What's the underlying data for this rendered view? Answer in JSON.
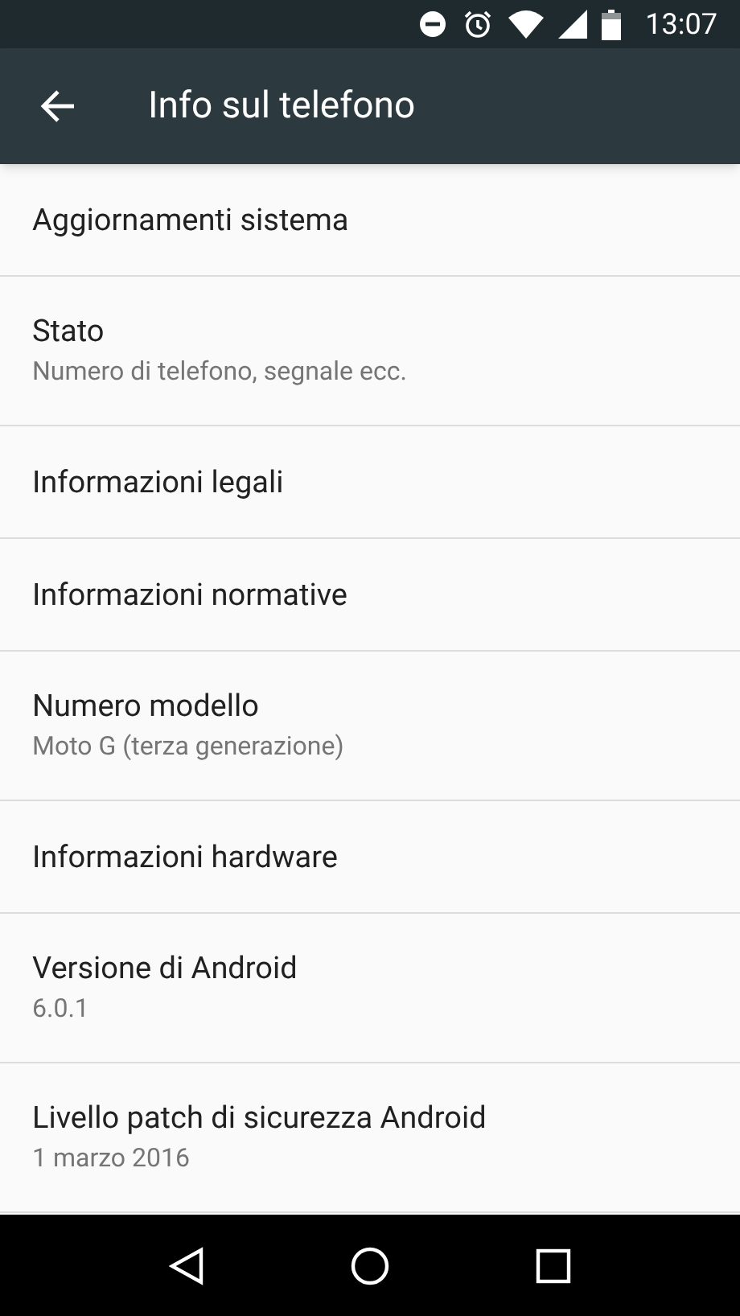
{
  "status_bar": {
    "time": "13:07"
  },
  "toolbar": {
    "title": "Info sul telefono"
  },
  "items": [
    {
      "title": "Aggiornamenti sistema"
    },
    {
      "title": "Stato",
      "summary": "Numero di telefono, segnale ecc."
    },
    {
      "title": "Informazioni legali"
    },
    {
      "title": "Informazioni normative"
    },
    {
      "title": "Numero modello",
      "summary": "Moto G (terza generazione)"
    },
    {
      "title": "Informazioni hardware"
    },
    {
      "title": "Versione di Android",
      "summary": "6.0.1"
    },
    {
      "title": "Livello patch di sicurezza Android",
      "summary": "1 marzo 2016"
    }
  ]
}
